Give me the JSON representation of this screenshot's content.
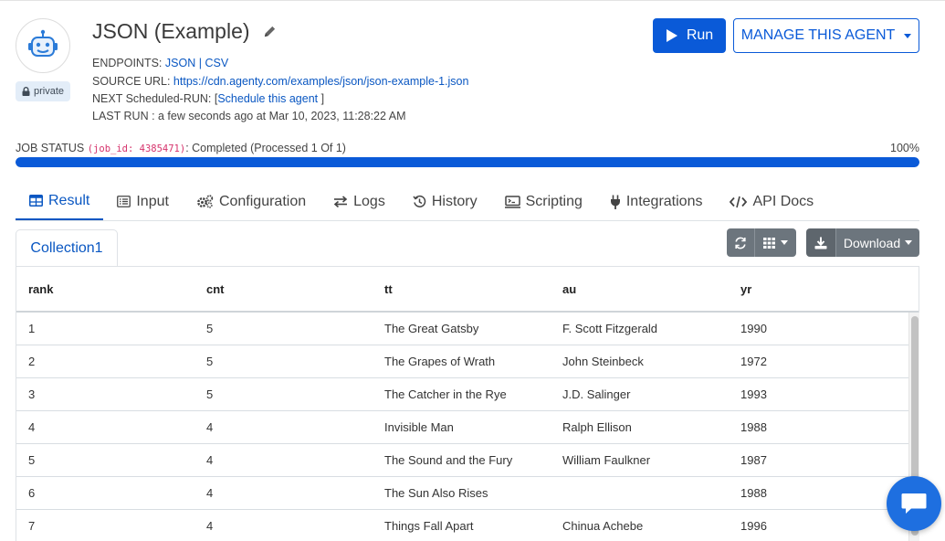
{
  "header": {
    "title": "JSON (Example)",
    "private_label": "private",
    "endpoints_label": "ENDPOINTS:",
    "endpoint_json": "JSON",
    "endpoint_sep": "|",
    "endpoint_csv": "CSV",
    "source_label": "SOURCE URL:",
    "source_url": "https://cdn.agenty.com/examples/json/json-example-1.json",
    "next_label": "NEXT Scheduled-RUN: [",
    "schedule_link": "Schedule this agent",
    "next_close": " ]",
    "last_run": "LAST RUN : a few seconds ago at Mar 10, 2023, 11:28:22 AM",
    "run_label": "Run",
    "manage_label": "MANAGE THIS AGENT"
  },
  "job": {
    "status_label": "JOB STATUS",
    "job_id_text": "(job_id: 4385471)",
    "status_text": ": Completed (Processed 1 Of 1)",
    "percent_text": "100%",
    "progress": 1.0
  },
  "tabs": [
    {
      "label": "Result",
      "icon": "table-icon"
    },
    {
      "label": "Input",
      "icon": "list-icon"
    },
    {
      "label": "Configuration",
      "icon": "cogs-icon"
    },
    {
      "label": "Logs",
      "icon": "exchange-icon"
    },
    {
      "label": "History",
      "icon": "history-icon"
    },
    {
      "label": "Scripting",
      "icon": "terminal-icon"
    },
    {
      "label": "Integrations",
      "icon": "plug-icon"
    },
    {
      "label": "API Docs",
      "icon": "code-icon"
    }
  ],
  "collection": {
    "tab_label": "Collection1",
    "download_label": "Download"
  },
  "table": {
    "columns": [
      "rank",
      "cnt",
      "tt",
      "au",
      "yr"
    ],
    "rows": [
      [
        "1",
        "5",
        "The Great Gatsby",
        "F. Scott Fitzgerald",
        "1990"
      ],
      [
        "2",
        "5",
        "The Grapes of Wrath",
        "John Steinbeck",
        "1972"
      ],
      [
        "3",
        "5",
        "The Catcher in the Rye",
        "J.D. Salinger",
        "1993"
      ],
      [
        "4",
        "4",
        "Invisible Man",
        "Ralph Ellison",
        "1988"
      ],
      [
        "5",
        "4",
        "The Sound and the Fury",
        "William Faulkner",
        "1987"
      ],
      [
        "6",
        "4",
        "The Sun Also Rises",
        "",
        "1988"
      ],
      [
        "7",
        "4",
        "Things Fall Apart",
        "Chinua Achebe",
        "1996"
      ]
    ]
  },
  "colors": {
    "primary": "#0a5ad8",
    "link": "#0a57c2",
    "code": "#d6336c",
    "secondary_button": "#6c757d"
  }
}
